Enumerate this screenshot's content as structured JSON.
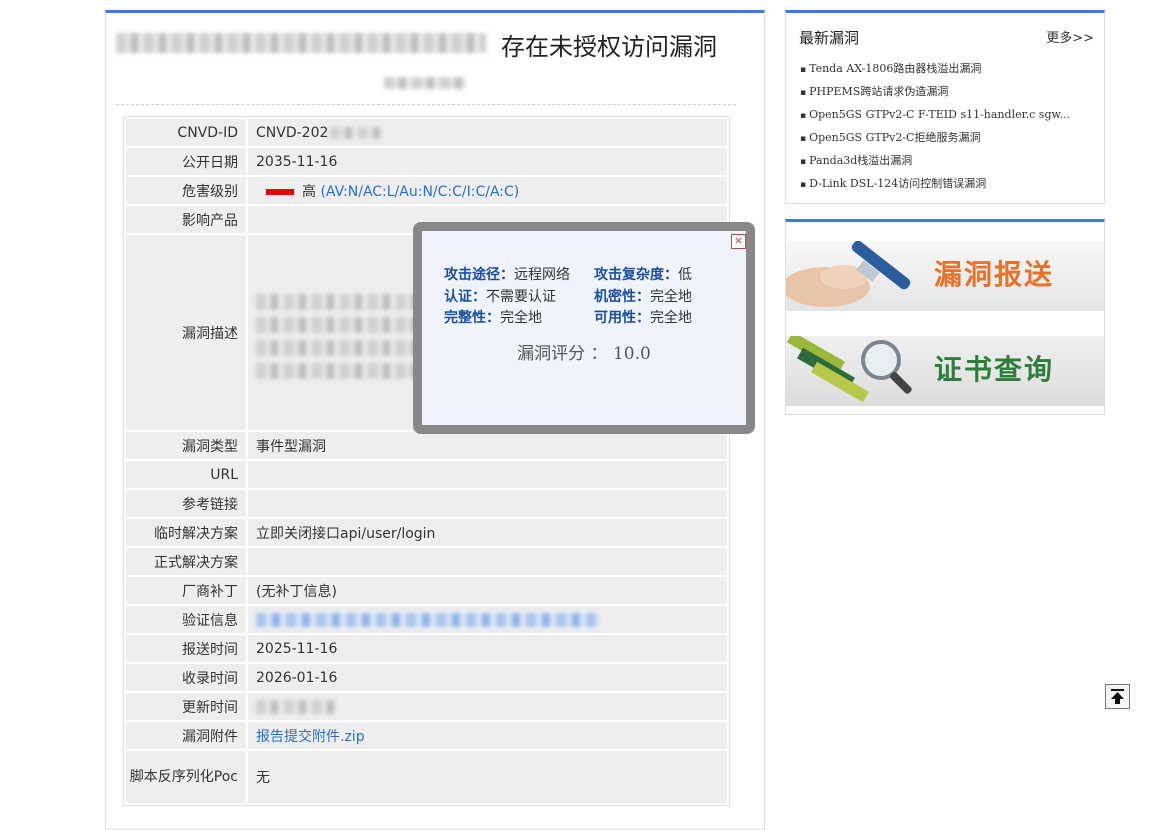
{
  "main": {
    "title_suffix": "存在未授权访问漏洞",
    "rows": {
      "cnvd_id": {
        "label": "CNVD-ID",
        "value": "CNVD-202"
      },
      "publish_date": {
        "label": "公开日期",
        "value": "2035-11-16"
      },
      "severity": {
        "label": "危害级别",
        "level": "高",
        "vector": "(AV:N/AC:L/Au:N/C:C/I:C/A:C)"
      },
      "products": {
        "label": "影响产品",
        "value": ""
      },
      "description": {
        "label": "漏洞描述"
      },
      "vuln_type": {
        "label": "漏洞类型",
        "value": "事件型漏洞"
      },
      "url": {
        "label": "URL",
        "value": ""
      },
      "references": {
        "label": "参考链接",
        "value": ""
      },
      "temp_solution": {
        "label": "临时解决方案",
        "value": "立即关闭接口api/user/login"
      },
      "formal_solution": {
        "label": "正式解决方案",
        "value": ""
      },
      "vendor_patch": {
        "label": "厂商补丁",
        "value": "(无补丁信息)"
      },
      "verification": {
        "label": "验证信息"
      },
      "report_time": {
        "label": "报送时间",
        "value": "2025-11-16"
      },
      "record_time": {
        "label": "收录时间",
        "value": "2026-01-16"
      },
      "update_time": {
        "label": "更新时间"
      },
      "attachment": {
        "label": "漏洞附件",
        "value": "报告提交附件.zip"
      },
      "script_poc": {
        "label": "脚本反序列化Poc",
        "value": "无"
      }
    }
  },
  "popup": {
    "close_symbol": "×",
    "attack_vector": {
      "label": "攻击途径：",
      "value": "远程网络"
    },
    "attack_complexity": {
      "label": "攻击复杂度：",
      "value": "低"
    },
    "authentication": {
      "label": "认证：",
      "value": "不需要认证"
    },
    "confidentiality": {
      "label": "机密性：",
      "value": "完全地"
    },
    "integrity": {
      "label": "完整性：",
      "value": "完全地"
    },
    "availability": {
      "label": "可用性：",
      "value": "完全地"
    },
    "score_text": "漏洞评分 ： 10.0"
  },
  "sidebar": {
    "latest_title": "最新漏洞",
    "more_label": "更多>>",
    "items": [
      "Tenda AX-1806路由器栈溢出漏洞",
      "PHPEMS跨站请求伪造漏洞",
      "Open5GS GTPv2-C F-TEID s11-handler.c sgw...",
      "Open5GS GTPv2-C拒绝服务漏洞",
      "Panda3d栈溢出漏洞",
      "D-Link DSL-124访问控制错误漏洞"
    ],
    "banner_report": "漏洞报送",
    "banner_cert": "证书查询"
  },
  "colors": {
    "accent": "#3a7fd5",
    "severity_high": "#e60000",
    "link": "#2a6fc9",
    "popup_label": "#1a4fa0"
  },
  "icons": {
    "back_to_top": "arrow-up-to-line-icon",
    "close": "close-icon"
  }
}
